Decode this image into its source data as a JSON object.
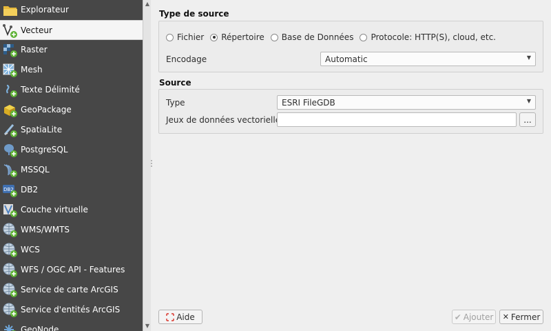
{
  "sidebar": {
    "items": [
      {
        "label": "Explorateur",
        "icon": "folder-icon"
      },
      {
        "label": "Vecteur",
        "icon": "vector-icon",
        "selected": true
      },
      {
        "label": "Raster",
        "icon": "raster-icon"
      },
      {
        "label": "Mesh",
        "icon": "mesh-icon"
      },
      {
        "label": "Texte Délimité",
        "icon": "delimited-text-icon"
      },
      {
        "label": "GeoPackage",
        "icon": "geopackage-icon"
      },
      {
        "label": "SpatiaLite",
        "icon": "spatialite-icon"
      },
      {
        "label": "PostgreSQL",
        "icon": "postgresql-icon"
      },
      {
        "label": "MSSQL",
        "icon": "mssql-icon"
      },
      {
        "label": "DB2",
        "icon": "db2-icon"
      },
      {
        "label": "Couche virtuelle",
        "icon": "virtual-layer-icon"
      },
      {
        "label": "WMS/WMTS",
        "icon": "wms-icon"
      },
      {
        "label": "WCS",
        "icon": "wcs-icon"
      },
      {
        "label": "WFS / OGC API - Features",
        "icon": "wfs-icon"
      },
      {
        "label": "Service de carte ArcGIS",
        "icon": "arcgis-map-icon"
      },
      {
        "label": "Service d'entités ArcGIS",
        "icon": "arcgis-feature-icon"
      },
      {
        "label": "GeoNode",
        "icon": "geonode-icon"
      }
    ],
    "db2_text": "DB2"
  },
  "source_type": {
    "title": "Type de source",
    "options": [
      {
        "label": "Fichier",
        "checked": false
      },
      {
        "label": "Répertoire",
        "checked": true
      },
      {
        "label": "Base de Données",
        "checked": false
      },
      {
        "label": "Protocole: HTTP(S), cloud, etc.",
        "checked": false
      }
    ],
    "encoding_label": "Encodage",
    "encoding_value": "Automatic"
  },
  "source": {
    "title": "Source",
    "type_label": "Type",
    "type_value": "ESRI FileGDB",
    "datasets_label": "Jeux de données vectorielles",
    "datasets_value": "",
    "browse_label": "..."
  },
  "footer": {
    "help_label": "Aide",
    "add_label": "Ajouter",
    "close_label": "Fermer"
  },
  "colors": {
    "sidebar_bg": "#474747",
    "accent_green": "#5fb336"
  }
}
